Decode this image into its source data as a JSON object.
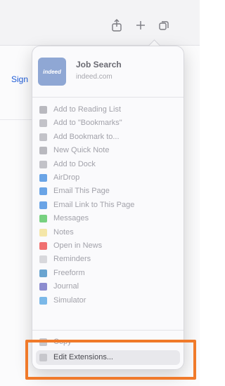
{
  "page": {
    "sign_link": "Sign"
  },
  "toolbar": {
    "share_icon": "share-icon",
    "new_tab_icon": "plus-icon",
    "tabs_icon": "tabs-overview-icon"
  },
  "share_menu": {
    "site": {
      "logo_text": "indeed",
      "title": "Job Search",
      "domain": "indeed.com"
    },
    "items": [
      {
        "label": "Add to Reading List",
        "icon": "reading-list-icon",
        "color": "#b9b9bf"
      },
      {
        "label": "Add to \"Bookmarks\"",
        "icon": "bookmark-icon",
        "color": "#c2c2c8"
      },
      {
        "label": "Add Bookmark to...",
        "icon": "book-icon",
        "color": "#c2c2c8"
      },
      {
        "label": "New Quick Note",
        "icon": "quick-note-icon",
        "color": "#b9b9bf"
      },
      {
        "label": "Add to Dock",
        "icon": "dock-icon",
        "color": "#c2c2c8"
      },
      {
        "label": "AirDrop",
        "icon": "airdrop-icon",
        "color": "#6aa4e6"
      },
      {
        "label": "Email This Page",
        "icon": "mail-icon",
        "color": "#6aa4e6"
      },
      {
        "label": "Email Link to This Page",
        "icon": "mail-link-icon",
        "color": "#6aa4e6"
      },
      {
        "label": "Messages",
        "icon": "messages-icon",
        "color": "#77d180"
      },
      {
        "label": "Notes",
        "icon": "notes-icon",
        "color": "#f4e6a8"
      },
      {
        "label": "Open in News",
        "icon": "news-icon",
        "color": "#f07070"
      },
      {
        "label": "Reminders",
        "icon": "reminders-icon",
        "color": "#d8d8dc"
      },
      {
        "label": "Freeform",
        "icon": "freeform-icon",
        "color": "#6aa4d0"
      },
      {
        "label": "Journal",
        "icon": "journal-icon",
        "color": "#8c8ccf"
      },
      {
        "label": "Simulator",
        "icon": "simulator-icon",
        "color": "#7bb8e8"
      },
      {
        "label": "Copy",
        "icon": "copy-icon",
        "color": "#c7c7cc"
      },
      {
        "label": "Edit Extensions...",
        "icon": "edit-extensions-icon",
        "color": "#c7c7cc"
      }
    ]
  }
}
